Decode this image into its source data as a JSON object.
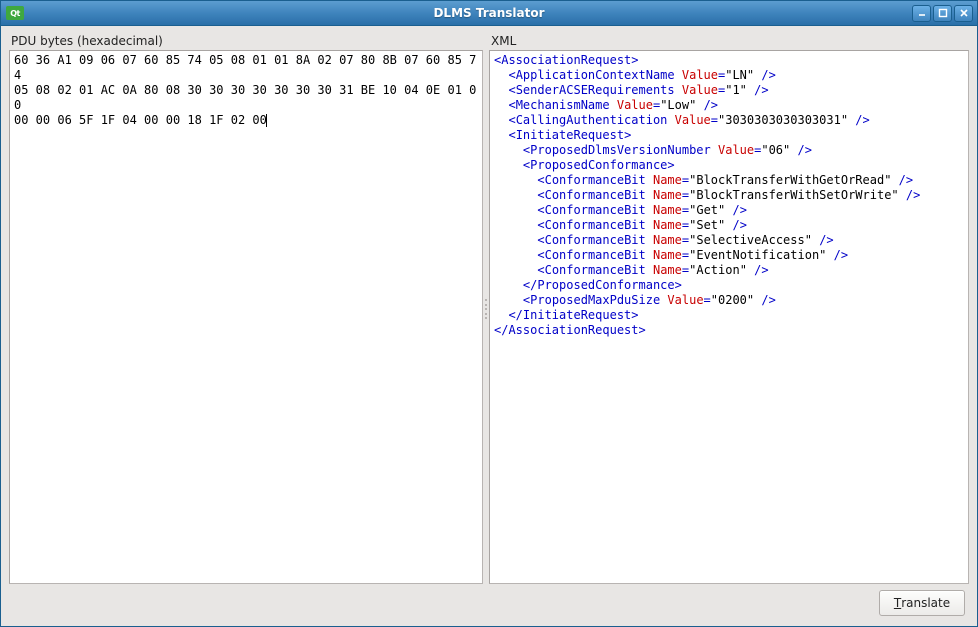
{
  "window": {
    "app_badge": "Qt",
    "title": "DLMS Translator"
  },
  "labels": {
    "pdu": "PDU bytes (hexadecimal)",
    "xml": "XML"
  },
  "buttons": {
    "translate": "Translate",
    "translate_mnemonic_index": 0
  },
  "pdu_hex": "60 36 A1 09 06 07 60 85 74 05 08 01 01 8A 02 07 80 8B 07 60 85 74 05 08 02 01 AC 0A 80 08 30 30 30 30 30 30 30 31 BE 10 04 0E 01 00 00 00 06 5F 1F 04 00 00 18 1F 02 00",
  "xml": {
    "root": "AssociationRequest",
    "children": [
      {
        "tag": "ApplicationContextName",
        "attr": "Value",
        "val": "LN",
        "selfclose": true,
        "indent": 1
      },
      {
        "tag": "SenderACSERequirements",
        "attr": "Value",
        "val": "1",
        "selfclose": true,
        "indent": 1
      },
      {
        "tag": "MechanismName",
        "attr": "Value",
        "val": "Low",
        "selfclose": true,
        "indent": 1
      },
      {
        "tag": "CallingAuthentication",
        "attr": "Value",
        "val": "3030303030303031",
        "selfclose": true,
        "indent": 1
      },
      {
        "tag": "InitiateRequest",
        "open": true,
        "indent": 1
      },
      {
        "tag": "ProposedDlmsVersionNumber",
        "attr": "Value",
        "val": "06",
        "selfclose": true,
        "indent": 2
      },
      {
        "tag": "ProposedConformance",
        "open": true,
        "indent": 2
      },
      {
        "tag": "ConformanceBit",
        "attr": "Name",
        "val": "BlockTransferWithGetOrRead",
        "selfclose": true,
        "indent": 3
      },
      {
        "tag": "ConformanceBit",
        "attr": "Name",
        "val": "BlockTransferWithSetOrWrite",
        "selfclose": true,
        "indent": 3
      },
      {
        "tag": "ConformanceBit",
        "attr": "Name",
        "val": "Get",
        "selfclose": true,
        "indent": 3
      },
      {
        "tag": "ConformanceBit",
        "attr": "Name",
        "val": "Set",
        "selfclose": true,
        "indent": 3
      },
      {
        "tag": "ConformanceBit",
        "attr": "Name",
        "val": "SelectiveAccess",
        "selfclose": true,
        "indent": 3
      },
      {
        "tag": "ConformanceBit",
        "attr": "Name",
        "val": "EventNotification",
        "selfclose": true,
        "indent": 3
      },
      {
        "tag": "ConformanceBit",
        "attr": "Name",
        "val": "Action",
        "selfclose": true,
        "indent": 3
      },
      {
        "tag": "ProposedConformance",
        "close": true,
        "indent": 2
      },
      {
        "tag": "ProposedMaxPduSize",
        "attr": "Value",
        "val": "0200",
        "selfclose": true,
        "indent": 2
      },
      {
        "tag": "InitiateRequest",
        "close": true,
        "indent": 1
      }
    ]
  }
}
